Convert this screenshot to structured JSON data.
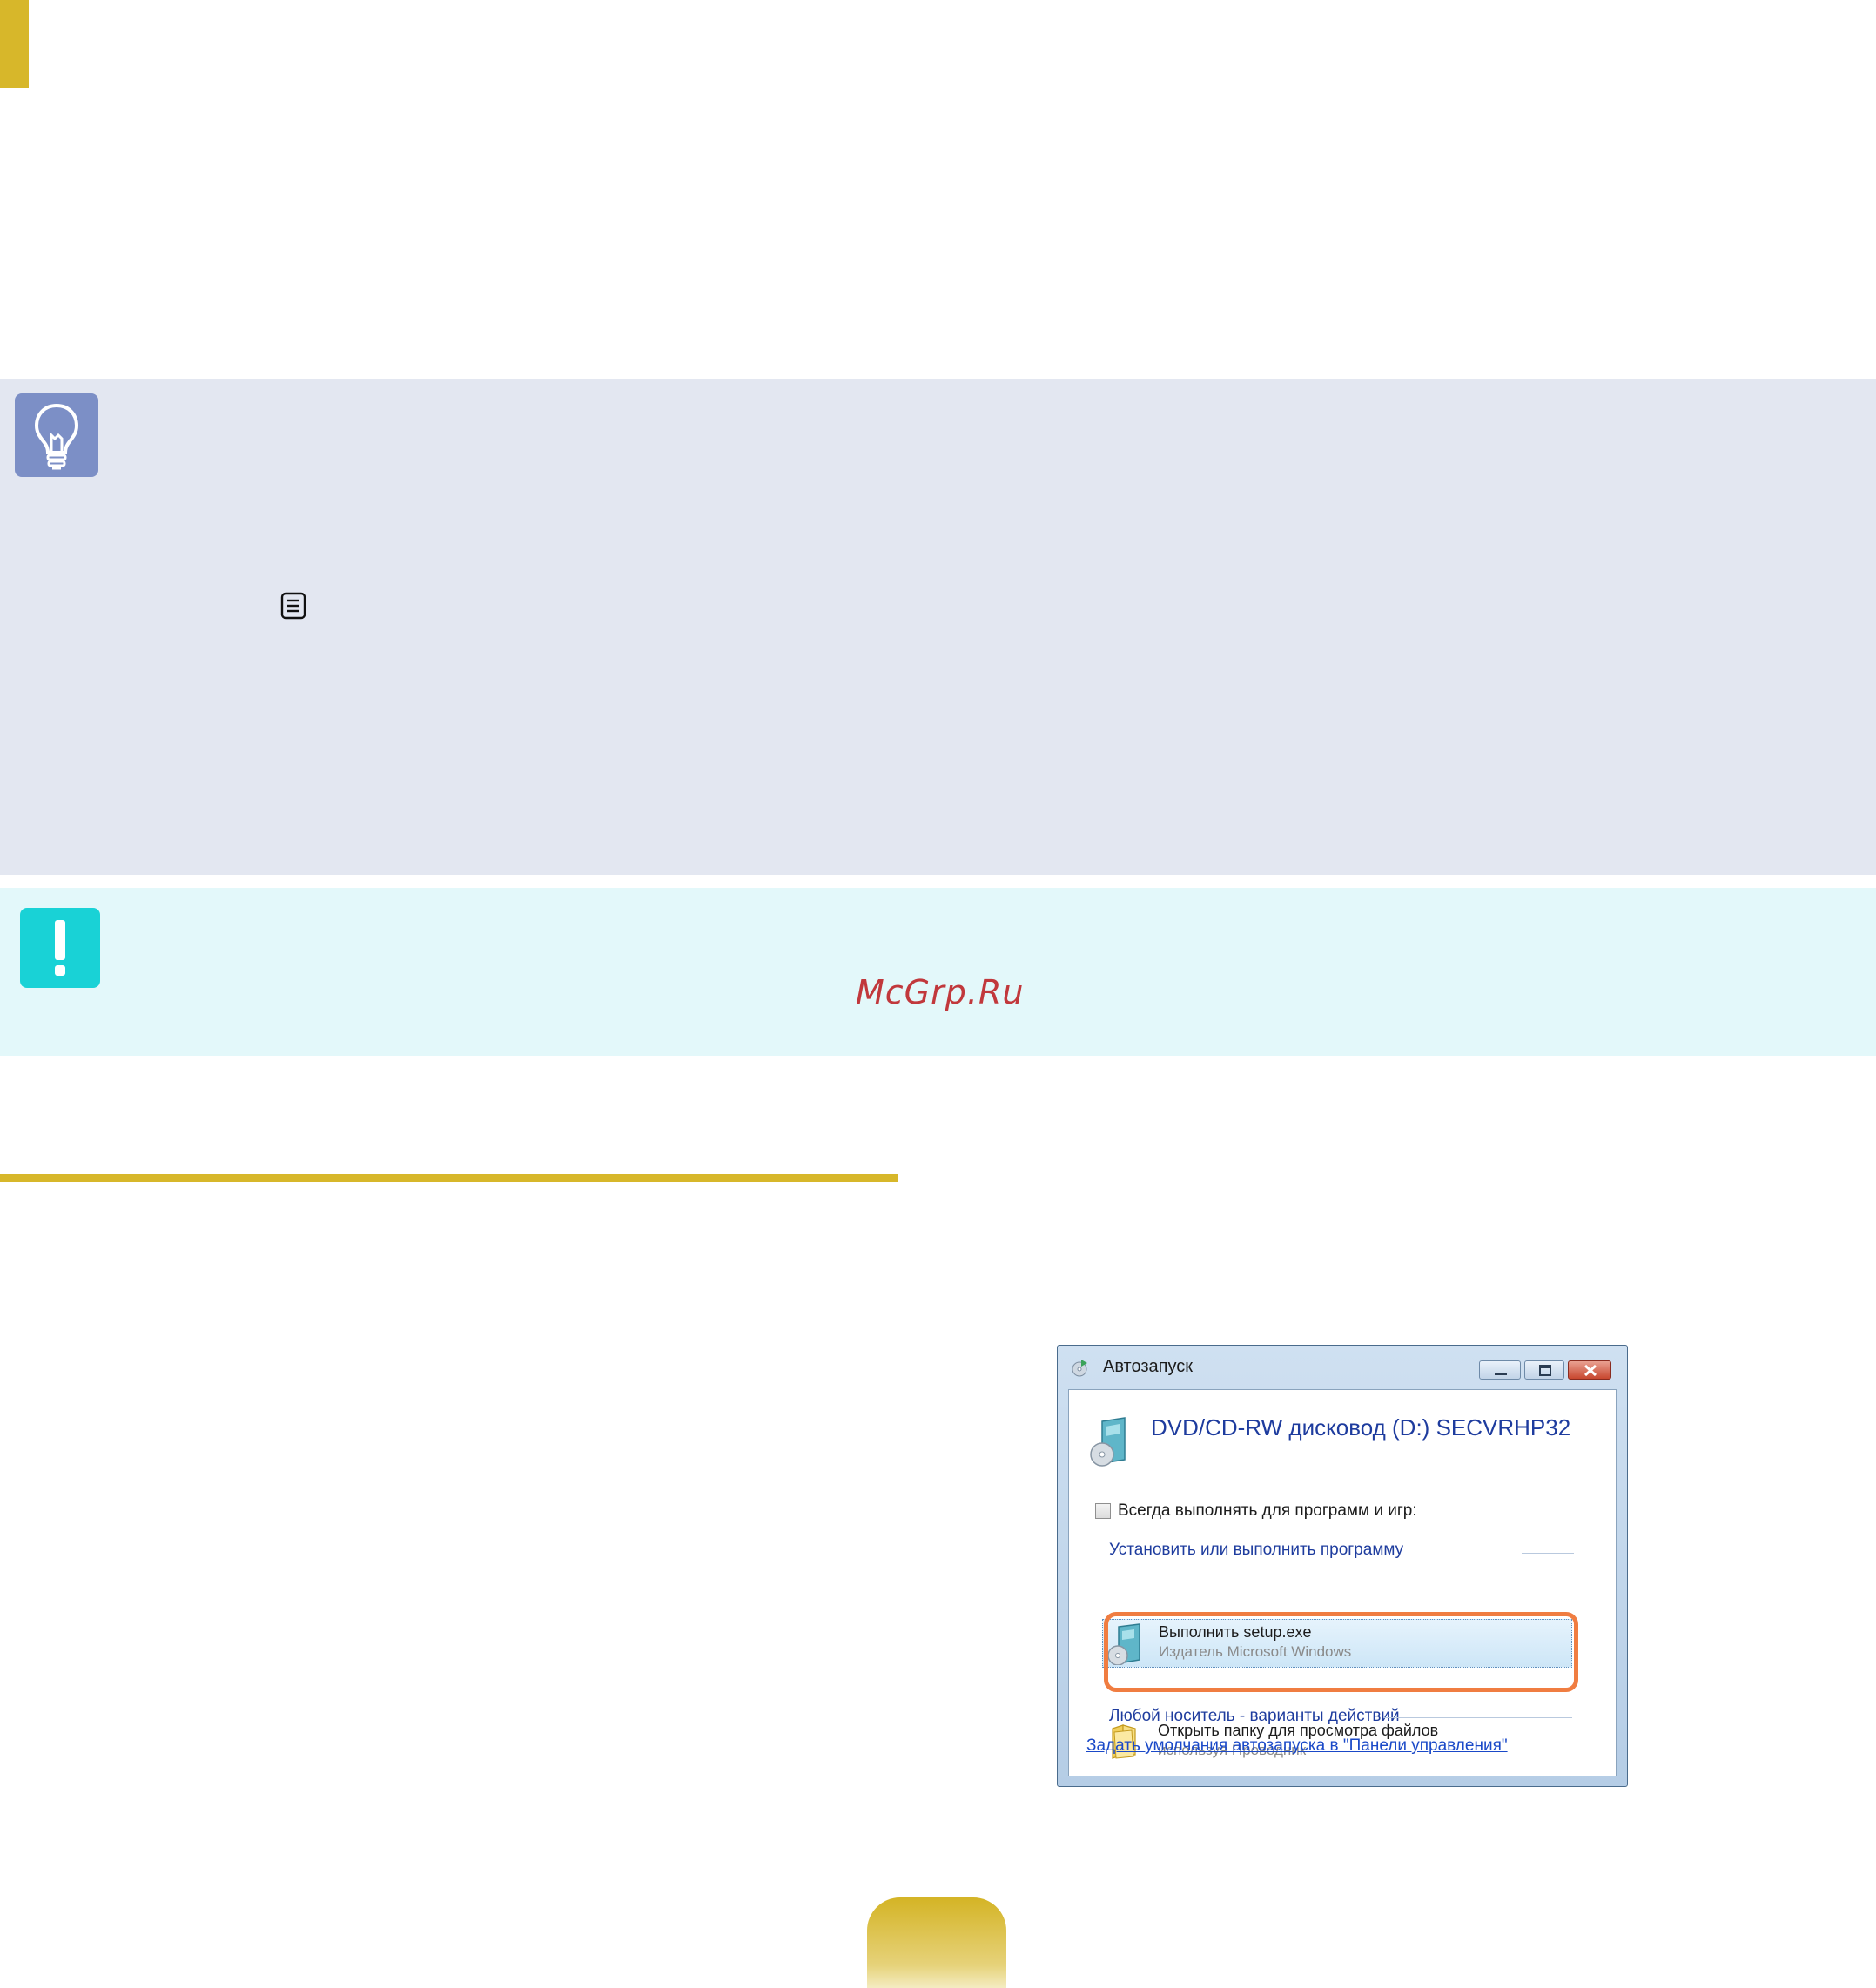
{
  "colors": {
    "accent_gold": "#d7b72a",
    "tip_background": "#e3e7f1",
    "tip_icon": "#7c8fc6",
    "warning_background": "#e3f8fa",
    "warning_icon": "#19d2d6",
    "watermark": "#c1383c",
    "highlight_frame": "#f07d41",
    "link_blue": "#1a49c8"
  },
  "tip": {
    "icon": "lightbulb-icon",
    "menu_key_icon": "menu-key-icon"
  },
  "warning": {
    "icon": "exclamation-icon"
  },
  "watermark": "McGrp.Ru",
  "dialog": {
    "title": "Автозапуск",
    "drive_title": "DVD/CD-RW дисковод (D:) SECVRHP32",
    "always_checkbox_label": "Всегда выполнять для программ и игр:",
    "always_checked": false,
    "group_install": "Установить или выполнить программу",
    "run_setup_title": "Выполнить setup.exe",
    "run_setup_sub": "Издатель Microsoft Windows",
    "group_media": "Любой носитель - варианты действий",
    "open_folder_title": "Открыть папку для просмотра файлов",
    "open_folder_sub": "используя Проводник",
    "defaults_link": "Задать умолчания автозапуска в \"Панели управления\"",
    "icons": {
      "title": "autoplay-icon",
      "minimize": "minimize-icon",
      "maximize": "maximize-icon",
      "close": "close-icon",
      "drive": "disc-drive-icon",
      "setup": "setup-disc-icon",
      "folder": "folder-icon"
    }
  }
}
